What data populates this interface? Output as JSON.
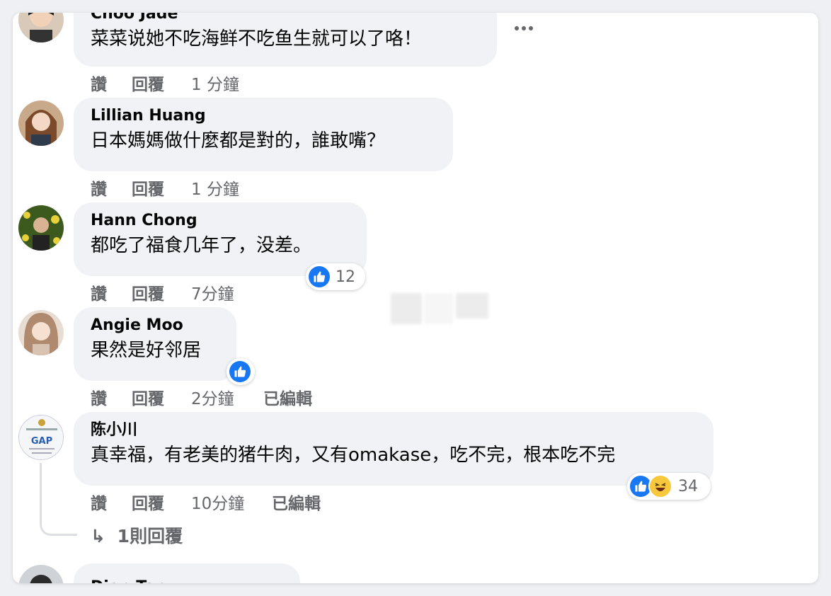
{
  "actions": {
    "like": "讚",
    "reply": "回覆",
    "edited": "已編輯"
  },
  "comments": [
    {
      "author": "Choo Jade",
      "text": "菜菜说她不吃海鲜不吃鱼生就可以了咯！",
      "time": "1 分鐘"
    },
    {
      "author": "Lillian Huang",
      "text": "日本媽媽做什麼都是對的，誰敢嘴？",
      "time": "1 分鐘"
    },
    {
      "author": "Hann Chong",
      "text": "都吃了福食几年了，没差。",
      "time": "7分鐘",
      "reaction_count": "12"
    },
    {
      "author": "Angie Moo",
      "text": "果然是好邻居",
      "time": "2分鐘"
    },
    {
      "author": "陈小川",
      "text": "真幸福，有老美的猪牛肉，又有omakase，吃不完，根本吃不完",
      "time": "10分鐘",
      "reaction_count": "34",
      "avatar_text": "GAP"
    }
  ],
  "replies_link": "1則回覆",
  "partial_author": "Dion Tan",
  "colors": {
    "like": "#1877f2",
    "bubble": "#f0f2f5",
    "meta": "#65676b",
    "haha": "#f7c83b"
  }
}
